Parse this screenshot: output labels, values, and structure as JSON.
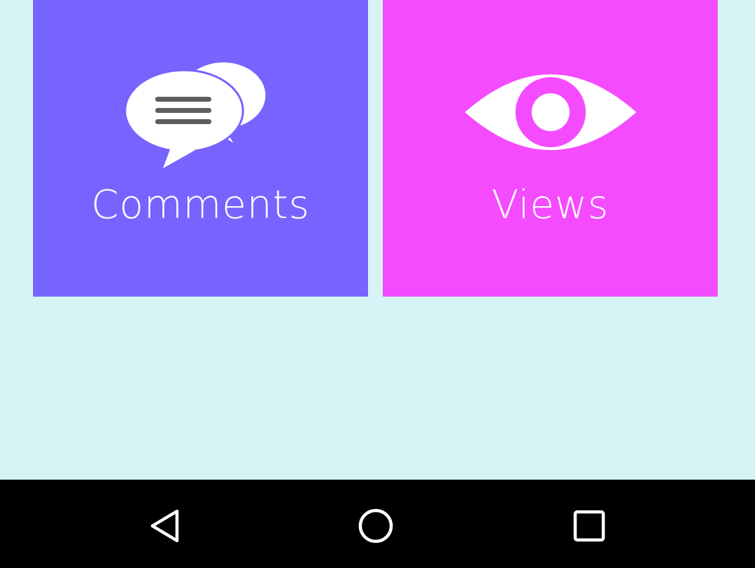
{
  "colors": {
    "background": "#d6f4f6",
    "comments_tile": "#7764ff",
    "views_tile": "#f54bff",
    "navbar": "#000000",
    "icon_white": "#ffffff",
    "line_gray": "#5f5f5f"
  },
  "tiles": [
    {
      "label": "Comments",
      "icon": "chat-bubbles-icon"
    },
    {
      "label": "Views",
      "icon": "eye-icon"
    }
  ],
  "navbar": {
    "buttons": [
      {
        "icon": "back-triangle-icon"
      },
      {
        "icon": "home-circle-icon"
      },
      {
        "icon": "recents-square-icon"
      }
    ]
  }
}
